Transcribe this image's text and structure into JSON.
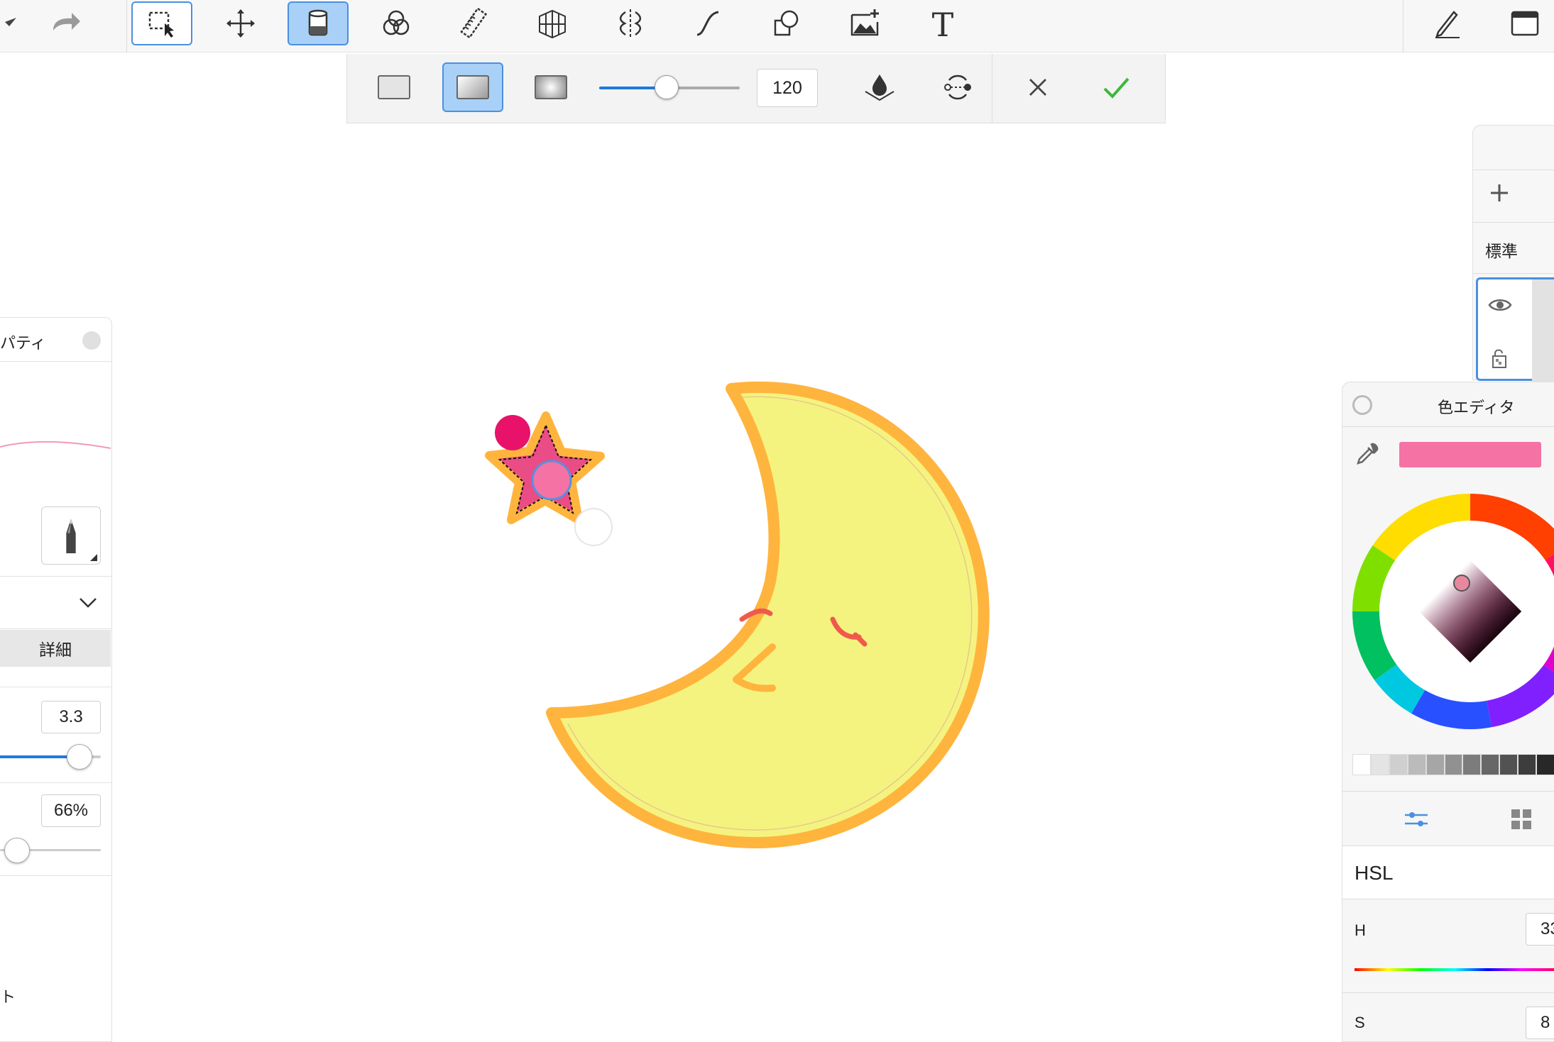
{
  "toolbar": {
    "tools": [
      "undo-icon",
      "redo-icon",
      "selection-icon",
      "transform-icon",
      "fill-icon",
      "blend-icon",
      "ruler-icon",
      "perspective-icon",
      "symmetry-icon",
      "curve-icon",
      "shape-icon",
      "image-add-icon",
      "text-icon",
      "pen-settings-icon",
      "window-icon"
    ],
    "active_tool": "fill-icon"
  },
  "fill_bar": {
    "modes": [
      "solid",
      "linear-gradient",
      "radial-gradient"
    ],
    "active_mode": "linear-gradient",
    "slider_value": 120,
    "value": "120"
  },
  "left_panel": {
    "title": "パティ",
    "detail_label": "詳細",
    "size_value": "3.3",
    "opacity_value": "66%",
    "bottom_label": "ト"
  },
  "layer_panel": {
    "blend_mode": "標準"
  },
  "color_editor": {
    "title": "色エディタ",
    "current_color": "#f472a4",
    "mode_label": "HSL",
    "h_label": "H",
    "h_value": "33",
    "s_label": "S",
    "s_value": "8",
    "grays": [
      "#ffffff",
      "#e4e4e4",
      "#cfcfcf",
      "#bbbbbb",
      "#a6a6a6",
      "#919191",
      "#7c7c7c",
      "#676767",
      "#525252",
      "#3d3d3d",
      "#282828"
    ]
  },
  "canvas": {
    "moon_fill": "#f5f37f",
    "moon_outline": "#ffb43e",
    "star_fill": "#ea4c86",
    "star_outline": "#ffb43e",
    "cheek_color": "#f05a4c"
  }
}
